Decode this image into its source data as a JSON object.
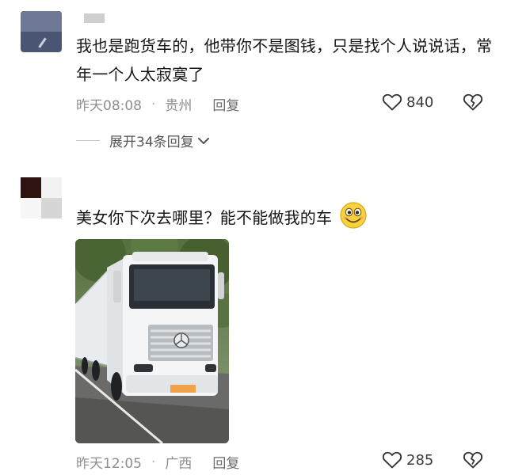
{
  "comments": [
    {
      "text": "我也是跑货车的，他带你不是图钱，只是找个人说说话，常年一个人太寂寞了",
      "time": "昨天08:08",
      "location": "贵州",
      "reply_label": "回复",
      "like_count": "840",
      "expand_label": "展开34条回复"
    },
    {
      "text": "美女你下次去哪里？能不能做我的车",
      "time": "昨天12:05",
      "location": "广西",
      "reply_label": "回复",
      "like_count": "285"
    }
  ],
  "icons": {
    "like": "heart-outline-icon",
    "dislike": "broken-heart-icon",
    "expand": "chevron-down-icon",
    "emoji": "smiling-face-emoji"
  },
  "colors": {
    "meta_text": "#8e8e8e",
    "body_text": "#161616",
    "emoji_face": "#f7d23c"
  }
}
